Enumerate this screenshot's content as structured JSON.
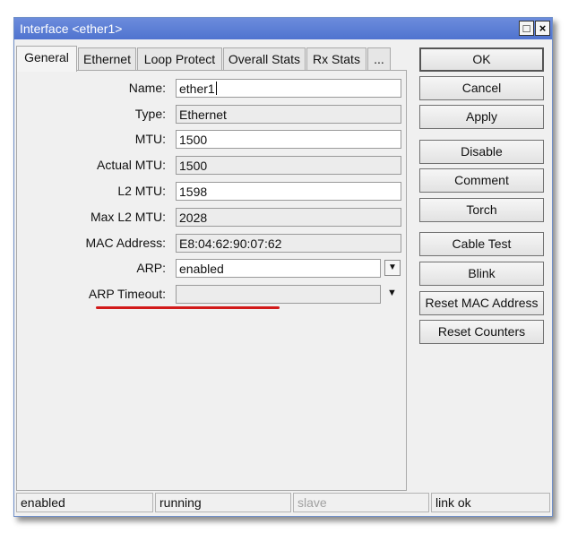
{
  "window": {
    "title": "Interface <ether1>"
  },
  "tabs": [
    "General",
    "Ethernet",
    "Loop Protect",
    "Overall Stats",
    "Rx Stats",
    "..."
  ],
  "form": {
    "name": {
      "label": "Name:",
      "value": "ether1"
    },
    "type": {
      "label": "Type:",
      "value": "Ethernet"
    },
    "mtu": {
      "label": "MTU:",
      "value": "1500"
    },
    "actual_mtu": {
      "label": "Actual MTU:",
      "value": "1500"
    },
    "l2_mtu": {
      "label": "L2 MTU:",
      "value": "1598"
    },
    "max_l2_mtu": {
      "label": "Max L2 MTU:",
      "value": "2028"
    },
    "mac_address": {
      "label": "MAC Address:",
      "value": "E8:04:62:90:07:62"
    },
    "arp": {
      "label": "ARP:",
      "value": "enabled"
    },
    "arp_timeout": {
      "label": "ARP Timeout:",
      "value": ""
    }
  },
  "buttons": {
    "ok": "OK",
    "cancel": "Cancel",
    "apply": "Apply",
    "disable": "Disable",
    "comment": "Comment",
    "torch": "Torch",
    "cable_test": "Cable Test",
    "blink": "Blink",
    "reset_mac": "Reset MAC Address",
    "reset_counters": "Reset Counters"
  },
  "status_bar": [
    "enabled",
    "running",
    "slave",
    "link ok"
  ],
  "annotation_color": "#d21a1a"
}
